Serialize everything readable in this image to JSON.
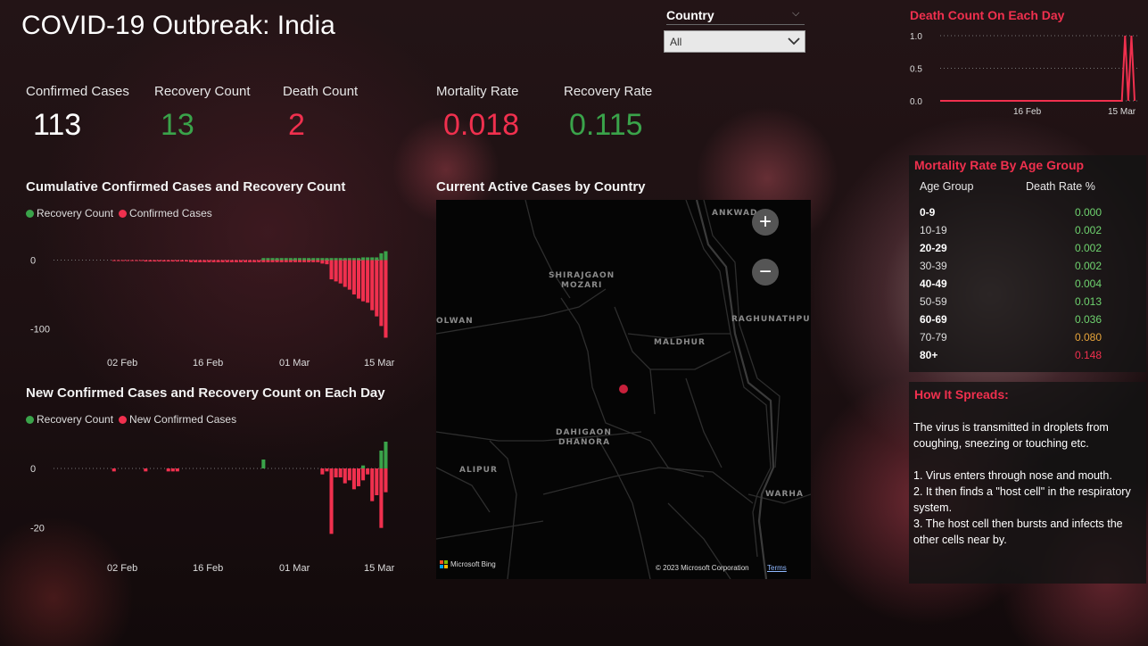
{
  "header": {
    "title": "COVID-19 Outbreak: India"
  },
  "slicer": {
    "title": "Country",
    "value": "All"
  },
  "kpis": [
    {
      "label": "Confirmed Cases",
      "value": "113",
      "color": "#ffffff"
    },
    {
      "label": "Recovery Count",
      "value": "13",
      "color": "#3aa34a"
    },
    {
      "label": "Death Count",
      "value": "2",
      "color": "#f0304e"
    },
    {
      "label": "Mortality Rate",
      "value": "0.018",
      "color": "#f0304e"
    },
    {
      "label": "Recovery Rate",
      "value": "0.115",
      "color": "#3aa34a"
    }
  ],
  "cumulative": {
    "title": "Cumulative Confirmed Cases and Recovery Count",
    "legend": [
      "Recovery Count",
      "Confirmed Cases"
    ]
  },
  "daily": {
    "title": "New Confirmed Cases and Recovery Count on Each Day",
    "legend": [
      "Recovery Count",
      "New Confirmed Cases"
    ]
  },
  "map": {
    "title": "Current Active Cases by Country",
    "labels": [
      "ANKWAD",
      "SHIRAJGAON",
      "MOZARI",
      "OLWAN",
      "RAGHUNATHPUR",
      "MALDHUR",
      "DAHIGAON",
      "DHANORA",
      "ALIPUR",
      "WARHA"
    ],
    "bing": "Microsoft Bing",
    "copyright": "© 2023 Microsoft Corporation",
    "terms": "Terms"
  },
  "deathchart": {
    "title": "Death Count On Each Day"
  },
  "age": {
    "title": "Mortality Rate By Age Group",
    "headers": [
      "Age Group",
      "Death Rate %"
    ],
    "rows": [
      {
        "group": "0-9",
        "rate": "0.000",
        "color": "#6fd36f"
      },
      {
        "group": "10-19",
        "rate": "0.002",
        "color": "#6fd36f"
      },
      {
        "group": "20-29",
        "rate": "0.002",
        "color": "#6fd36f"
      },
      {
        "group": "30-39",
        "rate": "0.002",
        "color": "#6fd36f"
      },
      {
        "group": "40-49",
        "rate": "0.004",
        "color": "#6fd36f"
      },
      {
        "group": "50-59",
        "rate": "0.013",
        "color": "#6fd36f"
      },
      {
        "group": "60-69",
        "rate": "0.036",
        "color": "#6fd36f"
      },
      {
        "group": "70-79",
        "rate": "0.080",
        "color": "#e8a53b"
      },
      {
        "group": "80+",
        "rate": "0.148",
        "color": "#f0304e"
      }
    ]
  },
  "spread": {
    "title": "How It Spreads:",
    "intro": "The virus is transmitted in droplets from coughing,  sneezing or touching etc.",
    "steps": [
      "1. Virus enters through nose and mouth.",
      "2. It then finds a \"host cell\" in the respiratory system.",
      "3. The host cell then bursts and infects the other cells near by."
    ]
  },
  "chart_data": [
    {
      "type": "bar",
      "title": "Cumulative Confirmed Cases and Recovery Count",
      "xlabels": [
        "02 Feb",
        "16 Feb",
        "01 Mar",
        "15 Mar"
      ],
      "yticks": [
        "0",
        "-100"
      ],
      "ylim": [
        -115,
        15
      ],
      "series": [
        {
          "name": "Recovery Count",
          "color": "#3aa34a",
          "values": [
            0,
            0,
            0,
            0,
            0,
            0,
            0,
            0,
            0,
            0,
            0,
            0,
            0,
            0,
            0,
            0,
            0,
            0,
            0,
            0,
            0,
            0,
            0,
            0,
            0,
            0,
            0,
            0,
            0,
            0,
            0,
            0,
            0,
            0,
            0,
            0,
            3,
            3,
            3,
            3,
            3,
            3,
            3,
            3,
            3,
            3,
            3,
            3,
            3,
            3,
            3,
            3,
            3,
            3,
            3,
            3,
            3,
            3,
            4,
            4,
            4,
            4,
            10,
            13
          ]
        },
        {
          "name": "Confirmed Cases",
          "color": "#f0304e",
          "values": [
            0,
            0,
            0,
            -1,
            -1,
            -1,
            -1,
            -1,
            -1,
            -1,
            -2,
            -2,
            -2,
            -2,
            -2,
            -2,
            -2,
            -2,
            -2,
            -2,
            -3,
            -3,
            -3,
            -3,
            -3,
            -3,
            -3,
            -3,
            -3,
            -3,
            -3,
            -3,
            -3,
            -3,
            -3,
            -3,
            -3,
            -3,
            -3,
            -3,
            -3,
            -3,
            -3,
            -3,
            -3,
            -3,
            -3,
            -3,
            -3,
            -5,
            -6,
            -28,
            -31,
            -34,
            -39,
            -43,
            -50,
            -56,
            -60,
            -62,
            -73,
            -82,
            -96,
            -113
          ]
        }
      ]
    },
    {
      "type": "bar",
      "title": "New Confirmed Cases and Recovery Count on Each Day",
      "xlabels": [
        "02 Feb",
        "16 Feb",
        "01 Mar",
        "15 Mar"
      ],
      "yticks": [
        "0",
        "-20"
      ],
      "ylim": [
        -24,
        9
      ],
      "series": [
        {
          "name": "Recovery Count",
          "color": "#3aa34a",
          "values": [
            0,
            0,
            0,
            0,
            0,
            0,
            0,
            0,
            0,
            0,
            0,
            0,
            0,
            0,
            0,
            0,
            0,
            0,
            0,
            0,
            0,
            0,
            0,
            0,
            0,
            0,
            0,
            0,
            0,
            0,
            0,
            0,
            0,
            0,
            0,
            0,
            3,
            0,
            0,
            0,
            0,
            0,
            0,
            0,
            0,
            0,
            0,
            0,
            0,
            0,
            0,
            0,
            0,
            0,
            0,
            0,
            0,
            0,
            1,
            0,
            0,
            0,
            6,
            9
          ]
        },
        {
          "name": "New Confirmed Cases",
          "color": "#f0304e",
          "values": [
            0,
            0,
            0,
            -1,
            0,
            0,
            0,
            0,
            0,
            0,
            -1,
            0,
            0,
            0,
            0,
            -1,
            -1,
            -1,
            0,
            0,
            0,
            0,
            0,
            0,
            0,
            0,
            0,
            0,
            0,
            0,
            0,
            0,
            0,
            0,
            0,
            0,
            0,
            0,
            0,
            0,
            0,
            0,
            0,
            0,
            0,
            0,
            0,
            0,
            0,
            -2,
            -1,
            -22,
            -3,
            -3,
            -5,
            -4,
            -7,
            -6,
            -4,
            -2,
            -11,
            -9,
            -20,
            -8
          ]
        }
      ]
    },
    {
      "type": "line",
      "title": "Death Count On Each Day",
      "xlabels": [
        "16 Feb",
        "15 Mar"
      ],
      "yticks": [
        "1.0",
        "0.5",
        "0.0"
      ],
      "ylim": [
        0,
        1
      ],
      "color": "#f0304e",
      "values": [
        0,
        0,
        0,
        0,
        0,
        0,
        0,
        0,
        0,
        0,
        0,
        0,
        0,
        0,
        0,
        0,
        0,
        0,
        0,
        0,
        0,
        0,
        0,
        0,
        0,
        0,
        0,
        0,
        0,
        0,
        0,
        0,
        0,
        0,
        0,
        0,
        0,
        0,
        0,
        0,
        0,
        0,
        0,
        0,
        0,
        0,
        0,
        0,
        0,
        0,
        0,
        0,
        0,
        0,
        0,
        0,
        0,
        0,
        1,
        0,
        1,
        0
      ]
    }
  ]
}
